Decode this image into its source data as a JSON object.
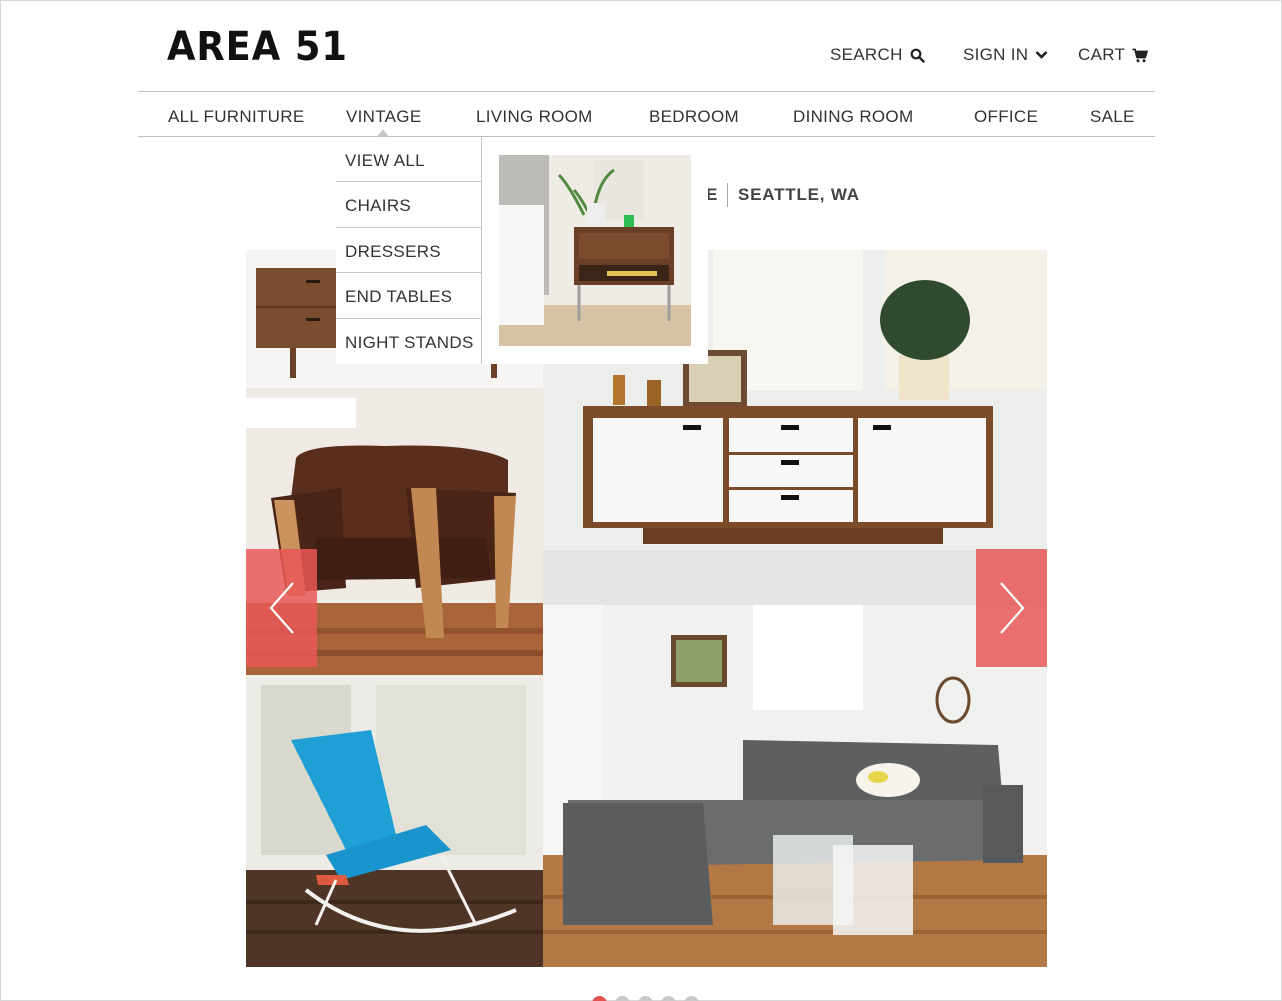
{
  "brand": {
    "logo": "AREA 51"
  },
  "header": {
    "search_label": "SEARCH",
    "signin_label": "SIGN IN",
    "cart_label": "CART"
  },
  "nav": {
    "items": [
      "ALL FURNITURE",
      "VINTAGE",
      "LIVING ROOM",
      "BEDROOM",
      "DINING ROOM",
      "OFFICE",
      "SALE"
    ]
  },
  "dropdown": {
    "items": [
      "VIEW ALL",
      "CHAIRS",
      "DRESSERS",
      "END TABLES",
      "NIGHT STANDS"
    ]
  },
  "hero": {
    "tagline_partial": "E",
    "tagline_location": "SEATTLE, WA"
  },
  "carousel": {
    "slide_count": 5,
    "active_index": 0
  },
  "colors": {
    "accent": "#e95858",
    "text": "#333333",
    "divider": "#bfbfbf"
  },
  "icons": {
    "search": "search-icon",
    "signin": "chevron-down-icon",
    "cart": "cart-icon",
    "prev": "chevron-left-icon",
    "next": "chevron-right-icon"
  }
}
